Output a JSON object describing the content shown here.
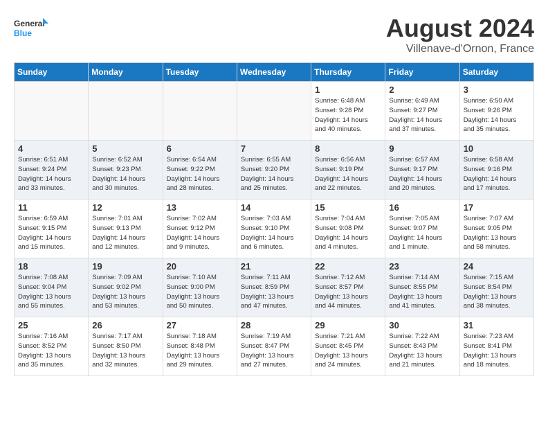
{
  "logo": {
    "text_general": "General",
    "text_blue": "Blue"
  },
  "title": "August 2024",
  "subtitle": "Villenave-d'Ornon, France",
  "headers": [
    "Sunday",
    "Monday",
    "Tuesday",
    "Wednesday",
    "Thursday",
    "Friday",
    "Saturday"
  ],
  "weeks": [
    [
      {
        "day": "",
        "info": ""
      },
      {
        "day": "",
        "info": ""
      },
      {
        "day": "",
        "info": ""
      },
      {
        "day": "",
        "info": ""
      },
      {
        "day": "1",
        "info": "Sunrise: 6:48 AM\nSunset: 9:28 PM\nDaylight: 14 hours\nand 40 minutes."
      },
      {
        "day": "2",
        "info": "Sunrise: 6:49 AM\nSunset: 9:27 PM\nDaylight: 14 hours\nand 37 minutes."
      },
      {
        "day": "3",
        "info": "Sunrise: 6:50 AM\nSunset: 9:26 PM\nDaylight: 14 hours\nand 35 minutes."
      }
    ],
    [
      {
        "day": "4",
        "info": "Sunrise: 6:51 AM\nSunset: 9:24 PM\nDaylight: 14 hours\nand 33 minutes."
      },
      {
        "day": "5",
        "info": "Sunrise: 6:52 AM\nSunset: 9:23 PM\nDaylight: 14 hours\nand 30 minutes."
      },
      {
        "day": "6",
        "info": "Sunrise: 6:54 AM\nSunset: 9:22 PM\nDaylight: 14 hours\nand 28 minutes."
      },
      {
        "day": "7",
        "info": "Sunrise: 6:55 AM\nSunset: 9:20 PM\nDaylight: 14 hours\nand 25 minutes."
      },
      {
        "day": "8",
        "info": "Sunrise: 6:56 AM\nSunset: 9:19 PM\nDaylight: 14 hours\nand 22 minutes."
      },
      {
        "day": "9",
        "info": "Sunrise: 6:57 AM\nSunset: 9:17 PM\nDaylight: 14 hours\nand 20 minutes."
      },
      {
        "day": "10",
        "info": "Sunrise: 6:58 AM\nSunset: 9:16 PM\nDaylight: 14 hours\nand 17 minutes."
      }
    ],
    [
      {
        "day": "11",
        "info": "Sunrise: 6:59 AM\nSunset: 9:15 PM\nDaylight: 14 hours\nand 15 minutes."
      },
      {
        "day": "12",
        "info": "Sunrise: 7:01 AM\nSunset: 9:13 PM\nDaylight: 14 hours\nand 12 minutes."
      },
      {
        "day": "13",
        "info": "Sunrise: 7:02 AM\nSunset: 9:12 PM\nDaylight: 14 hours\nand 9 minutes."
      },
      {
        "day": "14",
        "info": "Sunrise: 7:03 AM\nSunset: 9:10 PM\nDaylight: 14 hours\nand 6 minutes."
      },
      {
        "day": "15",
        "info": "Sunrise: 7:04 AM\nSunset: 9:08 PM\nDaylight: 14 hours\nand 4 minutes."
      },
      {
        "day": "16",
        "info": "Sunrise: 7:05 AM\nSunset: 9:07 PM\nDaylight: 14 hours\nand 1 minute."
      },
      {
        "day": "17",
        "info": "Sunrise: 7:07 AM\nSunset: 9:05 PM\nDaylight: 13 hours\nand 58 minutes."
      }
    ],
    [
      {
        "day": "18",
        "info": "Sunrise: 7:08 AM\nSunset: 9:04 PM\nDaylight: 13 hours\nand 55 minutes."
      },
      {
        "day": "19",
        "info": "Sunrise: 7:09 AM\nSunset: 9:02 PM\nDaylight: 13 hours\nand 53 minutes."
      },
      {
        "day": "20",
        "info": "Sunrise: 7:10 AM\nSunset: 9:00 PM\nDaylight: 13 hours\nand 50 minutes."
      },
      {
        "day": "21",
        "info": "Sunrise: 7:11 AM\nSunset: 8:59 PM\nDaylight: 13 hours\nand 47 minutes."
      },
      {
        "day": "22",
        "info": "Sunrise: 7:12 AM\nSunset: 8:57 PM\nDaylight: 13 hours\nand 44 minutes."
      },
      {
        "day": "23",
        "info": "Sunrise: 7:14 AM\nSunset: 8:55 PM\nDaylight: 13 hours\nand 41 minutes."
      },
      {
        "day": "24",
        "info": "Sunrise: 7:15 AM\nSunset: 8:54 PM\nDaylight: 13 hours\nand 38 minutes."
      }
    ],
    [
      {
        "day": "25",
        "info": "Sunrise: 7:16 AM\nSunset: 8:52 PM\nDaylight: 13 hours\nand 35 minutes."
      },
      {
        "day": "26",
        "info": "Sunrise: 7:17 AM\nSunset: 8:50 PM\nDaylight: 13 hours\nand 32 minutes."
      },
      {
        "day": "27",
        "info": "Sunrise: 7:18 AM\nSunset: 8:48 PM\nDaylight: 13 hours\nand 29 minutes."
      },
      {
        "day": "28",
        "info": "Sunrise: 7:19 AM\nSunset: 8:47 PM\nDaylight: 13 hours\nand 27 minutes."
      },
      {
        "day": "29",
        "info": "Sunrise: 7:21 AM\nSunset: 8:45 PM\nDaylight: 13 hours\nand 24 minutes."
      },
      {
        "day": "30",
        "info": "Sunrise: 7:22 AM\nSunset: 8:43 PM\nDaylight: 13 hours\nand 21 minutes."
      },
      {
        "day": "31",
        "info": "Sunrise: 7:23 AM\nSunset: 8:41 PM\nDaylight: 13 hours\nand 18 minutes."
      }
    ]
  ]
}
